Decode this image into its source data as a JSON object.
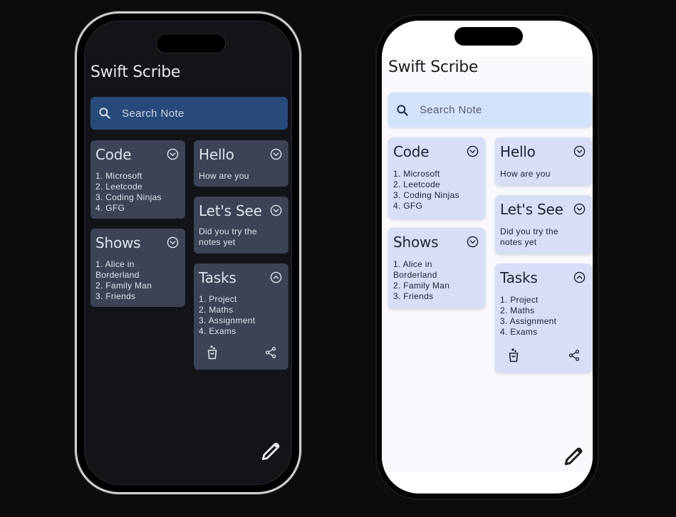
{
  "app": {
    "title": "Swift Scribe"
  },
  "search": {
    "placeholder": "Search Note",
    "icon": "search-icon"
  },
  "notes": [
    {
      "title": "Code",
      "items": [
        "1. Microsoft",
        "2. Leetcode",
        "3. Coding Ninjas",
        "4. GFG"
      ],
      "expanded": false,
      "toggle_icon": "chevron-down-circle-icon"
    },
    {
      "title": "Hello",
      "items": [
        "How are you"
      ],
      "expanded": false,
      "toggle_icon": "chevron-down-circle-icon"
    },
    {
      "title": "Let's See",
      "items": [
        "Did you try the",
        "notes yet"
      ],
      "expanded": false,
      "toggle_icon": "chevron-down-circle-icon"
    },
    {
      "title": "Shows",
      "items": [
        "1. Alice in",
        "Borderland",
        "2. Family Man",
        "3. Friends"
      ],
      "expanded": false,
      "toggle_icon": "chevron-down-circle-icon"
    },
    {
      "title": "Tasks",
      "items": [
        "1. Project",
        "2. Maths",
        "3. Assignment",
        "4. Exams"
      ],
      "expanded": true,
      "toggle_icon": "chevron-up-circle-icon",
      "actions": [
        "delete-icon",
        "share-icon"
      ]
    }
  ],
  "fab": {
    "icon": "pencil-icon"
  },
  "themes": {
    "dark": {
      "background": "#131418",
      "card": "#3c4354",
      "search": "#284a7a",
      "text": "#e8e8ec"
    },
    "light": {
      "background": "#f8f8fd",
      "card": "#d7def6",
      "search": "#d5e2fb",
      "text": "#1b1b1f"
    }
  }
}
